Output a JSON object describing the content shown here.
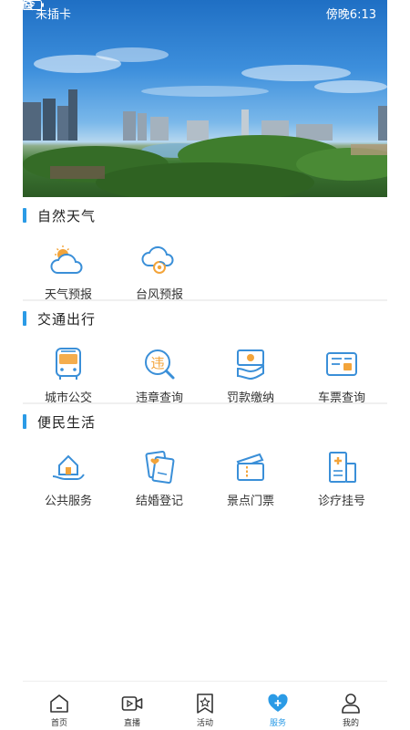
{
  "statusbar": {
    "carrier": "未插卡",
    "time": "傍晚6:13"
  },
  "sections": [
    {
      "title": "自然天气",
      "items": [
        {
          "label": "天气预报",
          "icon": "weather-cloud-sun-icon"
        },
        {
          "label": "台风预报",
          "icon": "typhoon-icon"
        }
      ]
    },
    {
      "title": "交通出行",
      "items": [
        {
          "label": "城市公交",
          "icon": "bus-icon"
        },
        {
          "label": "违章查询",
          "icon": "violation-search-icon"
        },
        {
          "label": "罚款缴纳",
          "icon": "fine-payment-icon"
        },
        {
          "label": "车票查询",
          "icon": "ticket-search-icon"
        }
      ]
    },
    {
      "title": "便民生活",
      "items": [
        {
          "label": "公共服务",
          "icon": "public-service-icon"
        },
        {
          "label": "结婚登记",
          "icon": "marriage-register-icon"
        },
        {
          "label": "景点门票",
          "icon": "scenic-ticket-icon"
        },
        {
          "label": "诊疗挂号",
          "icon": "hospital-register-icon"
        }
      ]
    }
  ],
  "tabs": [
    {
      "label": "首页",
      "icon": "home-icon",
      "active": false
    },
    {
      "label": "直播",
      "icon": "video-icon",
      "active": false
    },
    {
      "label": "活动",
      "icon": "activity-bookmark-icon",
      "active": false
    },
    {
      "label": "服务",
      "icon": "service-heart-icon",
      "active": true
    },
    {
      "label": "我的",
      "icon": "user-icon",
      "active": false
    }
  ],
  "colors": {
    "accent": "#2b9be6",
    "icon_blue": "#3a8fd8",
    "icon_orange": "#f3a43a"
  }
}
